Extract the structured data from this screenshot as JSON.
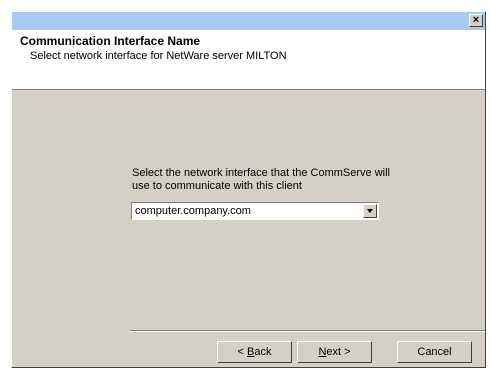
{
  "window": {
    "close_glyph": "×"
  },
  "header": {
    "title": "Communication Interface Name",
    "subtitle": "Select network interface for NetWare server MILTON"
  },
  "prompt": "Select the network interface that the CommServe will use to communicate with this client",
  "combo": {
    "selected_value": "computer.company.com"
  },
  "buttons": {
    "back_accel": "B",
    "back_rest": "ack",
    "back_prefix": "< ",
    "next_accel": "N",
    "next_rest": "ext",
    "next_suffix": " >",
    "cancel": "Cancel"
  },
  "colors": {
    "titlebar": "#a6caf0",
    "dialog_bg": "#d4d0c8",
    "header_bg": "#ffffff"
  }
}
